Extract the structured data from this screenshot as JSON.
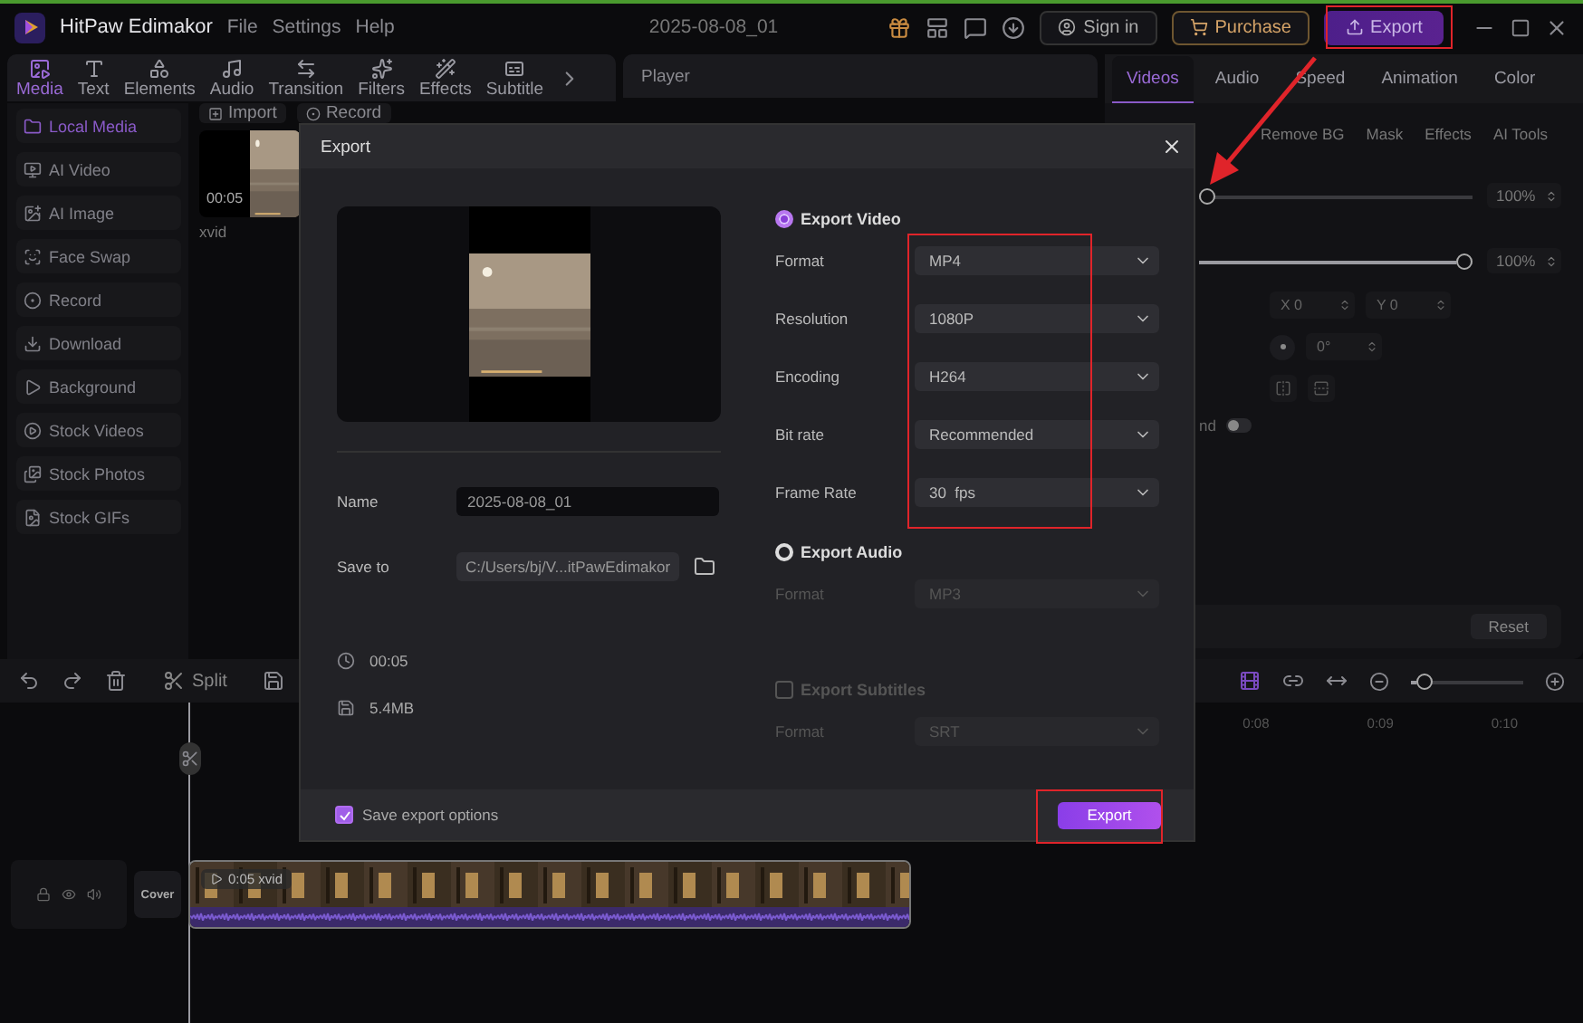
{
  "app": {
    "name": "HitPaw Edimakor",
    "menu": [
      "File",
      "Settings",
      "Help"
    ],
    "project_title": "2025-08-08_01",
    "buttons": [
      {
        "label": "Sign in",
        "kind": "account"
      },
      {
        "label": "Purchase",
        "kind": "purchase"
      },
      {
        "label": "Export",
        "kind": "export"
      }
    ]
  },
  "tool_tabs": [
    {
      "label": "Media",
      "selected": true
    },
    {
      "label": "Text",
      "selected": false
    },
    {
      "label": "Elements",
      "selected": false
    },
    {
      "label": "Audio",
      "selected": false
    },
    {
      "label": "Transition",
      "selected": false
    },
    {
      "label": "Filters",
      "selected": false
    },
    {
      "label": "Effects",
      "selected": false
    },
    {
      "label": "Subtitle",
      "selected": false
    }
  ],
  "media_sidebar": [
    {
      "label": "Local Media",
      "selected": true
    },
    {
      "label": "AI Video",
      "selected": false
    },
    {
      "label": "AI Image",
      "selected": false
    },
    {
      "label": "Face Swap",
      "selected": false
    },
    {
      "label": "Record",
      "selected": false
    },
    {
      "label": "Download",
      "selected": false
    },
    {
      "label": "Background",
      "selected": false
    },
    {
      "label": "Stock Videos",
      "selected": false
    },
    {
      "label": "Stock Photos",
      "selected": false
    },
    {
      "label": "Stock GIFs",
      "selected": false
    }
  ],
  "media_toolbar": {
    "import": "Import",
    "record": "Record"
  },
  "media_items": [
    {
      "duration": "00:05",
      "name": "xvid"
    }
  ],
  "player": {
    "title": "Player"
  },
  "property_tabs": [
    {
      "label": "Videos",
      "selected": true
    },
    {
      "label": "Audio",
      "selected": false
    },
    {
      "label": "Speed",
      "selected": false
    },
    {
      "label": "Animation",
      "selected": false
    },
    {
      "label": "Color",
      "selected": false
    }
  ],
  "property_subtabs": [
    {
      "label": "Remove BG",
      "selected": false
    },
    {
      "label": "Mask",
      "selected": false
    },
    {
      "label": "Effects",
      "selected": false
    },
    {
      "label": "AI Tools",
      "selected": false
    }
  ],
  "properties": {
    "sliders": [
      {
        "level": 0,
        "reading": "100%"
      },
      {
        "level": 1,
        "reading": "100%"
      }
    ],
    "position": [
      "X 0",
      "Y 0"
    ],
    "rotation": "0°",
    "toggle": {
      "label": "nd",
      "on": false
    },
    "reset": "Reset"
  },
  "timeline": {
    "split": "Split",
    "zoom": {
      "level": 0.05
    },
    "ruler": [
      "0:08",
      "0:09",
      "0:10"
    ],
    "cover": "Cover",
    "clip": "0:05 xvid"
  },
  "export_dialog": {
    "title": "Export",
    "name_label": "Name",
    "name": "2025-08-08_01",
    "save_to_label": "Save to",
    "path": "C:/Users/bj/V...itPawEdimakor",
    "duration": "00:05",
    "size": "5.4MB",
    "sections": [
      {
        "kind": "radio",
        "label": "Export Video",
        "selected": true,
        "fields": [
          {
            "label": "Format",
            "value": "MP4",
            "disabled": false
          },
          {
            "label": "Resolution",
            "value": "1080P",
            "disabled": false
          },
          {
            "label": "Encoding",
            "value": "H264",
            "disabled": false
          },
          {
            "label": "Bit rate",
            "value": "Recommended",
            "disabled": false
          },
          {
            "label": "Frame Rate",
            "value": "30  fps",
            "disabled": false
          }
        ]
      },
      {
        "kind": "radio",
        "label": "Export Audio",
        "selected": false,
        "fields": [
          {
            "label": "Format",
            "value": "MP3",
            "disabled": true
          }
        ]
      },
      {
        "kind": "checkbox",
        "label": "Export Subtitles",
        "checked": false,
        "fields": [
          {
            "label": "Format",
            "value": "SRT",
            "disabled": true
          }
        ]
      }
    ],
    "save_options": {
      "label": "Save export options",
      "checked": true
    },
    "export_button": "Export"
  }
}
